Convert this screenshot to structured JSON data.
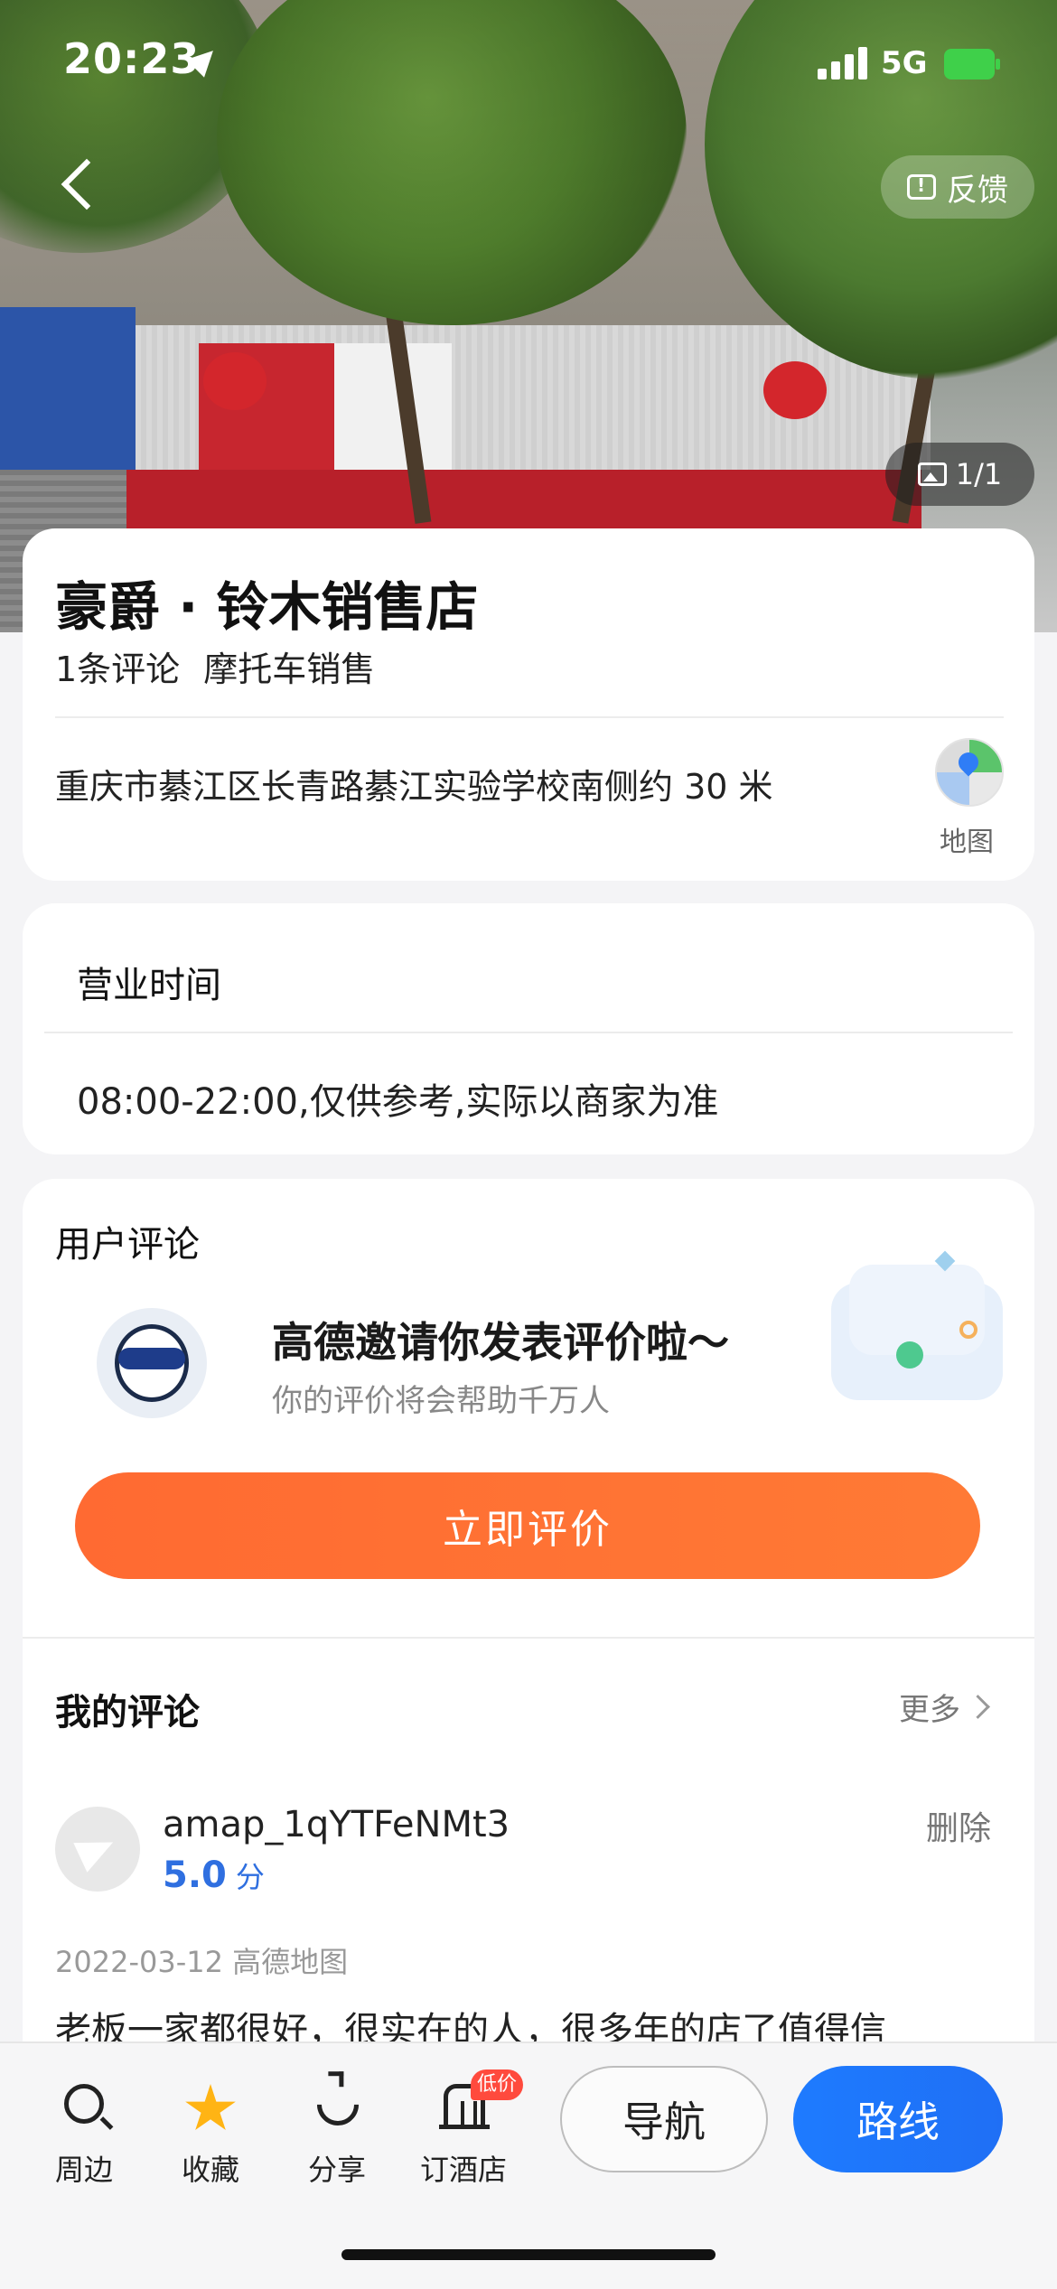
{
  "status_bar": {
    "time": "20:23",
    "network": "5G"
  },
  "header": {
    "feedback_label": "反馈",
    "photo_count": "1/1"
  },
  "poi": {
    "name": "豪爵 · 铃木销售店",
    "review_count": "1条评论",
    "category": "摩托车销售",
    "address": "重庆市綦江区长青路綦江实验学校南侧约 30 米",
    "map_label": "地图"
  },
  "hours": {
    "title": "营业时间",
    "text": "08:00-22:00,仅供参考,实际以商家为准"
  },
  "reviews": {
    "section_title": "用户评论",
    "invite_title": "高德邀请你发表评价啦～",
    "invite_subtitle": "你的评价将会帮助千万人",
    "review_button": "立即评价",
    "my_reviews_title": "我的评论",
    "more_label": "更多",
    "items": [
      {
        "user": "amap_1qYTFeNMt3",
        "score": "5.0",
        "score_unit": "分",
        "delete_label": "删除",
        "date_source": "2022-03-12 高德地图",
        "text": "老板一家都很好，很实在的人，很多年的店了值得信"
      }
    ]
  },
  "bottom_bar": {
    "around": "周边",
    "favorite": "收藏",
    "share": "分享",
    "hotel": "订酒店",
    "hotel_badge": "低价",
    "navigate": "导航",
    "route": "路线"
  },
  "colors": {
    "accent_orange": "#ff6a32",
    "primary_blue": "#1e7bff",
    "score_blue": "#2f6fe0",
    "star_yellow": "#ffb414"
  }
}
